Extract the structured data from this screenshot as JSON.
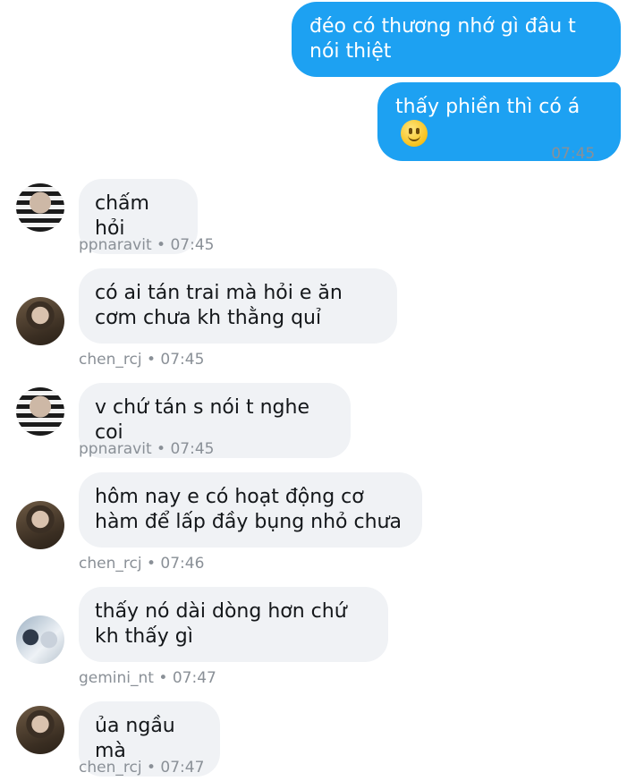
{
  "outgoing": {
    "messages": [
      "đéo có thương nhớ gì đâu t nói thiệt",
      "thấy phiền thì có á"
    ],
    "time": "07:45",
    "status_icon": "check-icon"
  },
  "incoming": [
    {
      "user": "ppnaravit",
      "time": "07:45",
      "text": "chấm hỏi"
    },
    {
      "user": "chen_rcj",
      "time": "07:45",
      "text": "có ai tán trai mà hỏi e ăn cơm chưa kh thằng quỉ"
    },
    {
      "user": "ppnaravit",
      "time": "07:45",
      "text": "v chứ tán s nói t nghe coi"
    },
    {
      "user": "chen_rcj",
      "time": "07:46",
      "text": "hôm nay e có hoạt động cơ hàm để lấp đầy bụng nhỏ chưa"
    },
    {
      "user": "gemini_nt",
      "time": "07:47",
      "text": "thấy nó dài dòng hơn chứ kh thấy gì"
    },
    {
      "user": "chen_rcj",
      "time": "07:47",
      "text": "ủa ngầu mà"
    }
  ],
  "meta_separator": " • ",
  "colors": {
    "accent": "#1DA1F2",
    "incoming_bubble": "#f0f2f5",
    "meta_text": "#8a9097"
  }
}
